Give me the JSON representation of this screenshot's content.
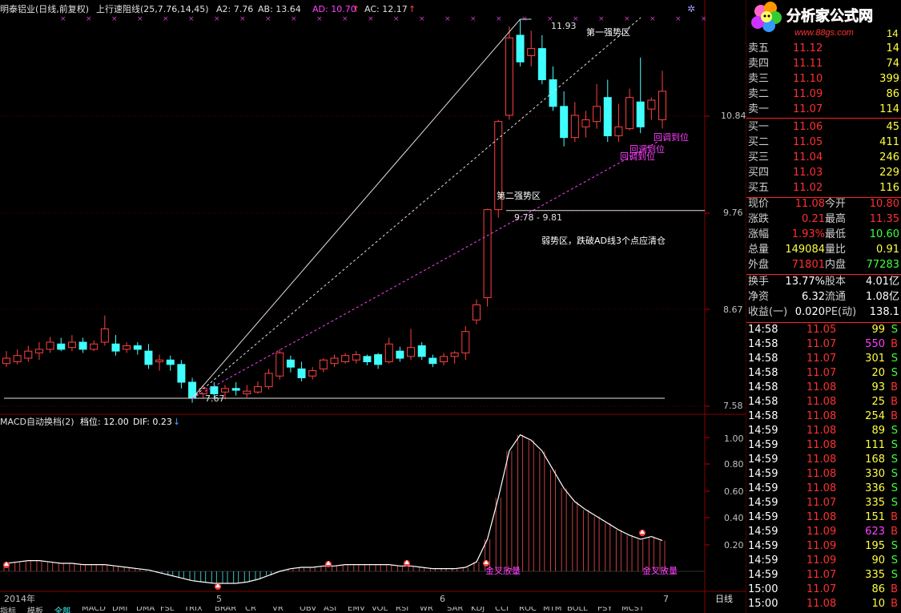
{
  "header": {
    "title": "明泰铝业(日线,前复权)",
    "indicator": "上行速阻线(25,7.76,14,45)",
    "a2": "A2: 7.76",
    "ab": "AB: 13.64",
    "ad": "AD: 10.70",
    "ac": "AC: 12.17"
  },
  "price_axis": {
    "labels": [
      "10.84",
      "9.76",
      "8.67",
      "7.58"
    ]
  },
  "macd_axis": {
    "labels": [
      "1.00",
      "0.80",
      "0.60",
      "0.40",
      "0.20"
    ]
  },
  "time_axis": {
    "labels": [
      "2014年",
      "5",
      "6",
      "7"
    ],
    "period": "日线"
  },
  "annotations": {
    "high_label": "11.93",
    "low_label": "7.67",
    "zone1": "第一强势区",
    "zone2": "第二强势区",
    "range": "9.78 - 9.81",
    "weak": "弱势区，跌破AD线3个点应清仓",
    "pullback": "回调到位",
    "golden_cross": "金叉放量"
  },
  "macd": {
    "title": "MACD自动换档(2)",
    "level": "档位: 12.00",
    "dif": "DIF: 0.23"
  },
  "tabs": [
    "指标",
    "模板",
    "全部",
    "MACD",
    "DMI",
    "DMA",
    "FSL",
    "TRIX",
    "BRAR",
    "CR",
    "VR",
    "OBV",
    "ASI",
    "EMV",
    "VOL",
    "RSI",
    "WR",
    "SAR",
    "KDJ",
    "CCI",
    "ROC",
    "MTM",
    "BOLL",
    "PSY",
    "MCST"
  ],
  "panel": {
    "logo": "分析家公式网",
    "logo_url": "www.88gs.com",
    "top_vol": "14",
    "sell": [
      {
        "label": "卖五",
        "price": "11.12",
        "vol": "14"
      },
      {
        "label": "卖四",
        "price": "11.11",
        "vol": "74"
      },
      {
        "label": "卖三",
        "price": "11.10",
        "vol": "399"
      },
      {
        "label": "卖二",
        "price": "11.09",
        "vol": "86"
      },
      {
        "label": "卖一",
        "price": "11.07",
        "vol": "114"
      }
    ],
    "buy": [
      {
        "label": "买一",
        "price": "11.06",
        "vol": "45"
      },
      {
        "label": "买二",
        "price": "11.05",
        "vol": "411"
      },
      {
        "label": "买三",
        "price": "11.04",
        "vol": "246"
      },
      {
        "label": "买四",
        "price": "11.03",
        "vol": "229"
      },
      {
        "label": "买五",
        "price": "11.02",
        "vol": "116"
      }
    ],
    "stats": [
      {
        "l1": "现价",
        "v1": "11.08",
        "l2": "今开",
        "v2": "10.80"
      },
      {
        "l1": "涨跌",
        "v1": "0.21",
        "l2": "最高",
        "v2": "11.35"
      },
      {
        "l1": "涨幅",
        "v1": "1.93%",
        "l2": "最低",
        "v2": "10.60"
      },
      {
        "l1": "总量",
        "v1": "149084",
        "l2": "量比",
        "v2": "0.91"
      },
      {
        "l1": "外盘",
        "v1": "71801",
        "l2": "内盘",
        "v2": "77283"
      }
    ],
    "info": [
      {
        "l1": "换手",
        "v1": "13.77%",
        "l2": "股本",
        "v2": "4.01亿"
      },
      {
        "l1": "净资",
        "v1": "6.32",
        "l2": "流通",
        "v2": "1.08亿"
      },
      {
        "l1": "收益(一)",
        "v1": "0.020",
        "l2": "PE(动)",
        "v2": "138.1"
      }
    ],
    "ticks": [
      {
        "t": "14:58",
        "p": "11.05",
        "v": "99",
        "s": "S"
      },
      {
        "t": "14:58",
        "p": "11.07",
        "v": "550",
        "s": "B"
      },
      {
        "t": "14:58",
        "p": "11.07",
        "v": "301",
        "s": "S"
      },
      {
        "t": "14:58",
        "p": "11.07",
        "v": "20",
        "s": "S"
      },
      {
        "t": "14:58",
        "p": "11.08",
        "v": "93",
        "s": "B"
      },
      {
        "t": "14:58",
        "p": "11.08",
        "v": "25",
        "s": "B"
      },
      {
        "t": "14:58",
        "p": "11.08",
        "v": "254",
        "s": "B"
      },
      {
        "t": "14:59",
        "p": "11.08",
        "v": "89",
        "s": "S"
      },
      {
        "t": "14:59",
        "p": "11.08",
        "v": "111",
        "s": "S"
      },
      {
        "t": "14:59",
        "p": "11.08",
        "v": "168",
        "s": "S"
      },
      {
        "t": "14:59",
        "p": "11.08",
        "v": "330",
        "s": "S"
      },
      {
        "t": "14:59",
        "p": "11.08",
        "v": "336",
        "s": "S"
      },
      {
        "t": "14:59",
        "p": "11.07",
        "v": "335",
        "s": "S"
      },
      {
        "t": "14:59",
        "p": "11.08",
        "v": "151",
        "s": "B"
      },
      {
        "t": "14:59",
        "p": "11.09",
        "v": "623",
        "s": "B"
      },
      {
        "t": "14:59",
        "p": "11.09",
        "v": "195",
        "s": "S"
      },
      {
        "t": "14:59",
        "p": "11.09",
        "v": "90",
        "s": "S"
      },
      {
        "t": "14:59",
        "p": "11.07",
        "v": "335",
        "s": "S"
      },
      {
        "t": "15:00",
        "p": "11.07",
        "v": "86",
        "s": "B"
      },
      {
        "t": "15:00",
        "p": "11.08",
        "v": "10",
        "s": "B"
      }
    ]
  },
  "chart_data": {
    "type": "candlestick",
    "series_name": "明泰铝业",
    "candles": [
      [
        8.06,
        8.12,
        8.02,
        8.2
      ],
      [
        8.08,
        8.15,
        8.05,
        8.22
      ],
      [
        8.12,
        8.2,
        8.08,
        8.26
      ],
      [
        8.18,
        8.22,
        8.1,
        8.3
      ],
      [
        8.22,
        8.3,
        8.18,
        8.36
      ],
      [
        8.28,
        8.22,
        8.2,
        8.35
      ],
      [
        8.24,
        8.3,
        8.2,
        8.38
      ],
      [
        8.3,
        8.22,
        8.18,
        8.35
      ],
      [
        8.22,
        8.28,
        8.2,
        8.32
      ],
      [
        8.3,
        8.45,
        8.26,
        8.6
      ],
      [
        8.28,
        8.2,
        8.15,
        8.38
      ],
      [
        8.22,
        8.26,
        8.18,
        8.3
      ],
      [
        8.26,
        8.22,
        8.16,
        8.3
      ],
      [
        8.2,
        8.05,
        8.0,
        8.28
      ],
      [
        8.08,
        8.1,
        7.98,
        8.16
      ],
      [
        8.1,
        8.05,
        7.98,
        8.15
      ],
      [
        8.05,
        7.85,
        7.78,
        8.1
      ],
      [
        7.85,
        7.67,
        7.62,
        7.9
      ],
      [
        7.72,
        7.78,
        7.67,
        7.82
      ],
      [
        7.8,
        7.72,
        7.67,
        7.85
      ],
      [
        7.74,
        7.78,
        7.66,
        7.82
      ],
      [
        7.78,
        7.76,
        7.7,
        7.85
      ],
      [
        7.72,
        7.75,
        7.68,
        7.82
      ],
      [
        7.74,
        7.8,
        7.72,
        7.86
      ],
      [
        7.8,
        7.95,
        7.77,
        8.0
      ],
      [
        7.92,
        8.18,
        7.88,
        8.22
      ],
      [
        8.1,
        8.02,
        7.96,
        8.15
      ],
      [
        8.0,
        7.9,
        7.86,
        8.08
      ],
      [
        7.92,
        7.98,
        7.88,
        8.02
      ],
      [
        8.0,
        8.1,
        7.96,
        8.12
      ],
      [
        8.06,
        8.12,
        8.02,
        8.16
      ],
      [
        8.08,
        8.15,
        8.06,
        8.18
      ],
      [
        8.1,
        8.16,
        8.06,
        8.2
      ],
      [
        8.14,
        8.08,
        8.04,
        8.16
      ],
      [
        8.16,
        8.05,
        8.0,
        8.18
      ],
      [
        8.08,
        8.28,
        8.06,
        8.35
      ],
      [
        8.2,
        8.12,
        8.08,
        8.25
      ],
      [
        8.14,
        8.24,
        8.1,
        8.45
      ],
      [
        8.26,
        8.14,
        8.1,
        8.3
      ],
      [
        8.12,
        8.06,
        8.02,
        8.16
      ],
      [
        8.08,
        8.14,
        8.04,
        8.18
      ],
      [
        8.14,
        8.18,
        8.06,
        8.2
      ],
      [
        8.18,
        8.42,
        8.1,
        8.48
      ],
      [
        8.55,
        8.72,
        8.5,
        8.78
      ],
      [
        8.8,
        9.79,
        8.7,
        9.8
      ],
      [
        9.79,
        10.78,
        9.7,
        10.8
      ],
      [
        10.85,
        11.72,
        10.8,
        11.85
      ],
      [
        11.75,
        11.45,
        11.4,
        11.93
      ],
      [
        11.52,
        11.6,
        11.4,
        11.8
      ],
      [
        11.6,
        11.25,
        11.2,
        11.75
      ],
      [
        11.25,
        10.95,
        10.9,
        11.4
      ],
      [
        10.95,
        10.6,
        10.5,
        11.12
      ],
      [
        10.6,
        10.85,
        10.55,
        11.0
      ],
      [
        10.72,
        10.8,
        10.6,
        10.9
      ],
      [
        10.78,
        10.95,
        10.7,
        11.2
      ],
      [
        11.05,
        10.62,
        10.55,
        11.25
      ],
      [
        10.62,
        10.72,
        10.55,
        10.98
      ],
      [
        10.7,
        11.05,
        10.68,
        11.15
      ],
      [
        11.0,
        10.72,
        10.65,
        11.5
      ],
      [
        10.92,
        11.02,
        10.8,
        11.05
      ],
      [
        10.8,
        11.12,
        10.7,
        11.35
      ]
    ],
    "price_ticks": [
      10.84,
      9.76,
      8.67,
      7.58
    ],
    "macd_dif": [
      0.06,
      0.07,
      0.08,
      0.08,
      0.07,
      0.06,
      0.06,
      0.05,
      0.05,
      0.05,
      0.04,
      0.03,
      0.02,
      0.01,
      -0.01,
      -0.03,
      -0.05,
      -0.07,
      -0.08,
      -0.09,
      -0.09,
      -0.09,
      -0.08,
      -0.06,
      -0.03,
      0.0,
      0.02,
      0.03,
      0.03,
      0.04,
      0.04,
      0.05,
      0.05,
      0.05,
      0.05,
      0.05,
      0.04,
      0.04,
      0.03,
      0.02,
      0.02,
      0.02,
      0.03,
      0.07,
      0.24,
      0.55,
      0.9,
      1.02,
      0.98,
      0.9,
      0.76,
      0.62,
      0.52,
      0.46,
      0.41,
      0.36,
      0.31,
      0.27,
      0.24,
      0.26,
      0.23
    ],
    "macd_ticks": [
      1.0,
      0.8,
      0.6,
      0.4,
      0.2
    ]
  }
}
